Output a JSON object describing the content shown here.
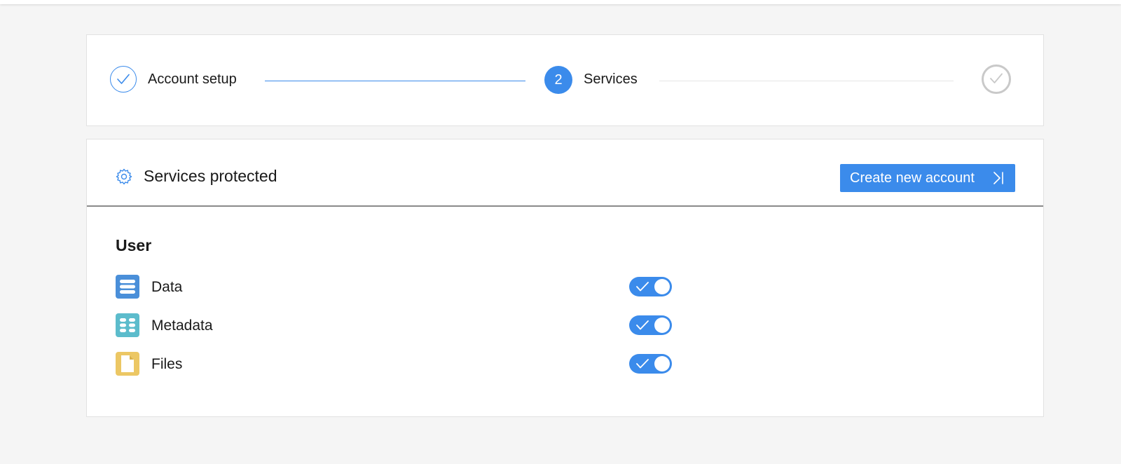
{
  "stepper": {
    "steps": [
      {
        "label": "Account setup",
        "state": "completed"
      },
      {
        "label": "Services",
        "number": "2",
        "state": "active"
      },
      {
        "state": "pending"
      }
    ]
  },
  "services": {
    "title": "Services protected",
    "create_button_label": "Create new account",
    "section_title": "User",
    "items": [
      {
        "label": "Data",
        "icon": "database-icon",
        "color": "#4a8fd9",
        "enabled": true
      },
      {
        "label": "Metadata",
        "icon": "grid-icon",
        "color": "#5cbccc",
        "enabled": true
      },
      {
        "label": "Files",
        "icon": "file-icon",
        "color": "#ecc764",
        "enabled": true
      }
    ]
  },
  "colors": {
    "accent": "#3b8beb"
  }
}
